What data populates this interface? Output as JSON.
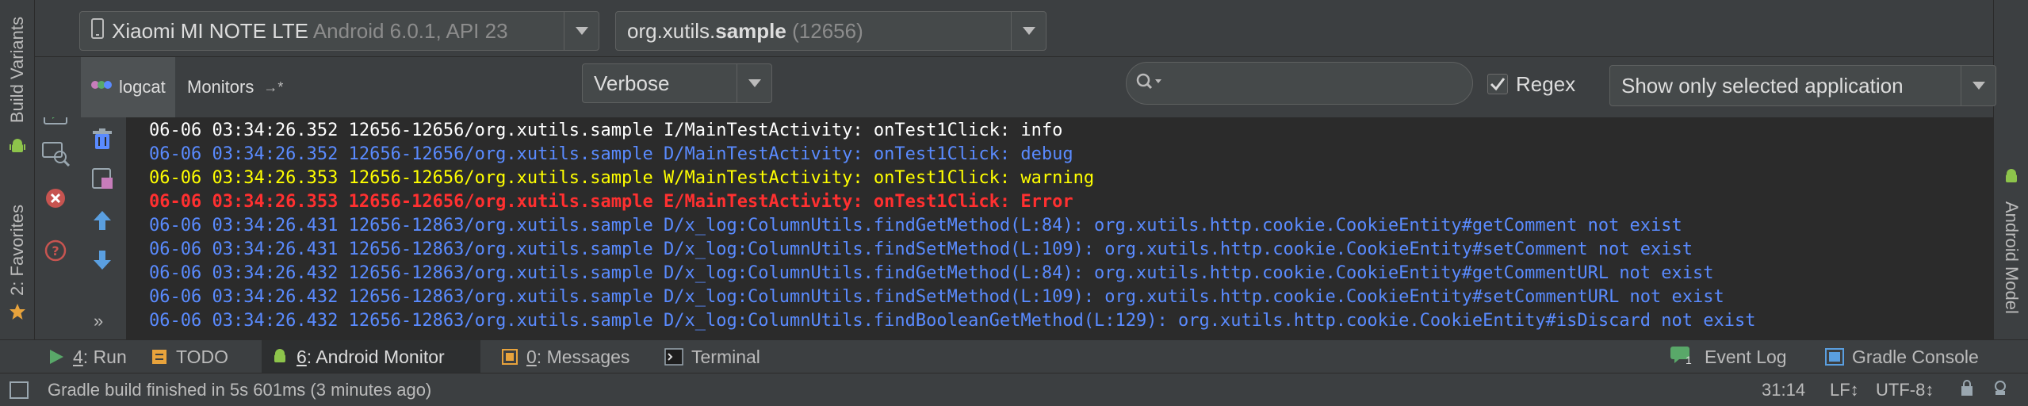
{
  "left_strip": {
    "build_variants": "Build Variants",
    "favorites": "2: Favorites"
  },
  "right_strip": {
    "android_model": "Android Model"
  },
  "device": {
    "name": "Xiaomi MI NOTE LTE",
    "details": "Android 6.0.1, API 23"
  },
  "process": {
    "name_prefix": "org.xutils.",
    "name_bold": "sample",
    "pid": "(12656)"
  },
  "tabs": {
    "logcat": "logcat",
    "monitors": "Monitors"
  },
  "filters": {
    "level": "Verbose",
    "search_placeholder": "",
    "regex_label": "Regex",
    "regex_checked": true,
    "app_filter": "Show only selected application"
  },
  "log_lines": [
    {
      "level": "info",
      "text": "06-06 03:34:26.352 12656-12656/org.xutils.sample I/MainTestActivity: onTest1Click: info"
    },
    {
      "level": "debug",
      "text": "06-06 03:34:26.352 12656-12656/org.xutils.sample D/MainTestActivity: onTest1Click: debug"
    },
    {
      "level": "warning",
      "text": "06-06 03:34:26.353 12656-12656/org.xutils.sample W/MainTestActivity: onTest1Click: warning"
    },
    {
      "level": "error",
      "text": "06-06 03:34:26.353 12656-12656/org.xutils.sample E/MainTestActivity: onTest1Click: Error"
    },
    {
      "level": "debug",
      "text": "06-06 03:34:26.431 12656-12863/org.xutils.sample D/x_log:ColumnUtils.findGetMethod(L:84): org.xutils.http.cookie.CookieEntity#getComment not exist"
    },
    {
      "level": "debug",
      "text": "06-06 03:34:26.431 12656-12863/org.xutils.sample D/x_log:ColumnUtils.findSetMethod(L:109): org.xutils.http.cookie.CookieEntity#setComment not exist"
    },
    {
      "level": "debug",
      "text": "06-06 03:34:26.432 12656-12863/org.xutils.sample D/x_log:ColumnUtils.findGetMethod(L:84): org.xutils.http.cookie.CookieEntity#getCommentURL not exist"
    },
    {
      "level": "debug",
      "text": "06-06 03:34:26.432 12656-12863/org.xutils.sample D/x_log:ColumnUtils.findSetMethod(L:109): org.xutils.http.cookie.CookieEntity#setCommentURL not exist"
    },
    {
      "level": "debug",
      "text": "06-06 03:34:26.432 12656-12863/org.xutils.sample D/x_log:ColumnUtils.findBooleanGetMethod(L:129): org.xutils.http.cookie.CookieEntity#isDiscard not exist"
    }
  ],
  "tool_tabs": {
    "run_num": "4",
    "run": ": Run",
    "todo": "TODO",
    "monitor_num": "6",
    "monitor": ": Android Monitor",
    "messages_num": "0",
    "messages": ": Messages",
    "terminal": "Terminal",
    "event_log_count": "1",
    "event_log": "Event Log",
    "gradle_console": "Gradle Console"
  },
  "status": {
    "message": "Gradle build finished in 5s 601ms (3 minutes ago)",
    "position": "31:14",
    "line_sep": "LF↕",
    "encoding": "UTF-8↕"
  },
  "colors": {
    "info": "#ffffff",
    "debug": "#5a8bff",
    "warning": "#ffff00",
    "error": "#ff3030",
    "background": "#2b2b2b",
    "panel": "#3c3f41"
  }
}
